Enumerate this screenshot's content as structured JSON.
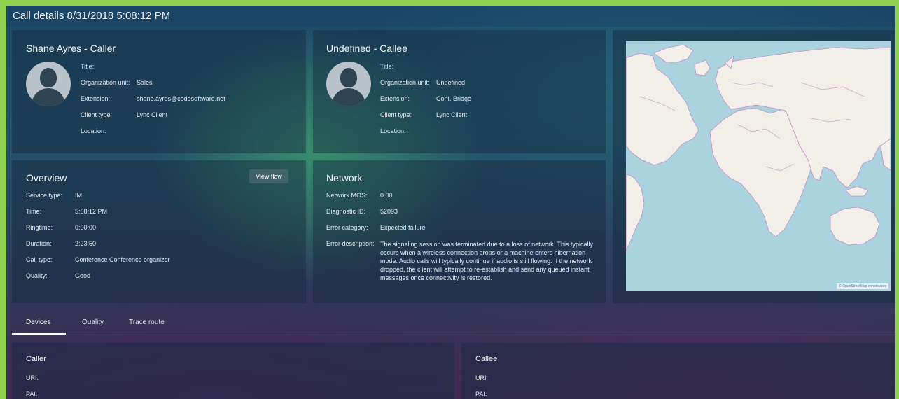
{
  "window": {
    "title": "Call details 8/31/2018 5:08:12 PM"
  },
  "caller": {
    "heading": "Shane Ayres - Caller",
    "fields": [
      {
        "label": "Title:",
        "value": ""
      },
      {
        "label": "Organization unit:",
        "value": "Sales"
      },
      {
        "label": "Extension:",
        "value": "shane.ayres@codesoftware.net"
      },
      {
        "label": "Client type:",
        "value": "Lync Client"
      },
      {
        "label": "Location:",
        "value": ""
      }
    ]
  },
  "callee": {
    "heading": "Undefined - Callee",
    "fields": [
      {
        "label": "Title:",
        "value": ""
      },
      {
        "label": "Organization unit:",
        "value": "Undefined"
      },
      {
        "label": "Extension:",
        "value": "Conf. Bridge"
      },
      {
        "label": "Client type:",
        "value": "Lync Client"
      },
      {
        "label": "Location:",
        "value": ""
      }
    ]
  },
  "overview": {
    "heading": "Overview",
    "view_flow_label": "View flow",
    "fields": [
      {
        "label": "Service type:",
        "value": "IM"
      },
      {
        "label": "Time:",
        "value": "5:08:12 PM"
      },
      {
        "label": "Ringtime:",
        "value": "0:00:00"
      },
      {
        "label": "Duration:",
        "value": "2:23:50"
      },
      {
        "label": "Call type:",
        "value": "Conference Conference organizer"
      },
      {
        "label": "Quality:",
        "value": "Good"
      }
    ]
  },
  "network": {
    "heading": "Network",
    "fields": [
      {
        "label": "Network MOS:",
        "value": "0.00"
      },
      {
        "label": "Diagnostic ID:",
        "value": "52093"
      },
      {
        "label": "Error category:",
        "value": "Expected failure"
      },
      {
        "label": "Error description:",
        "value": "The signaling session was terminated due to a loss of network. This typically occurs when a wireless connection drops or a machine enters hibernation mode. Audio calls will typically continue if audio is still flowing. If the network dropped, the client will attempt to re-establish and send any queued instant messages once connectivity is restored."
      }
    ]
  },
  "map": {
    "attribution": "© OpenStreetMap contributors"
  },
  "tabs": [
    {
      "label": "Devices",
      "active": true
    },
    {
      "label": "Quality",
      "active": false
    },
    {
      "label": "Trace route",
      "active": false
    }
  ],
  "devices": {
    "caller": {
      "heading": "Caller",
      "fields": [
        {
          "label": "URI:"
        },
        {
          "label": "PAI:"
        }
      ]
    },
    "callee": {
      "heading": "Callee",
      "fields": [
        {
          "label": "URI:"
        },
        {
          "label": "PAI:"
        }
      ]
    }
  },
  "colors": {
    "frame_border": "#8fd14f",
    "map_water": "#aad3df",
    "map_land": "#f2efe9",
    "map_borders": "#c28cc4"
  }
}
